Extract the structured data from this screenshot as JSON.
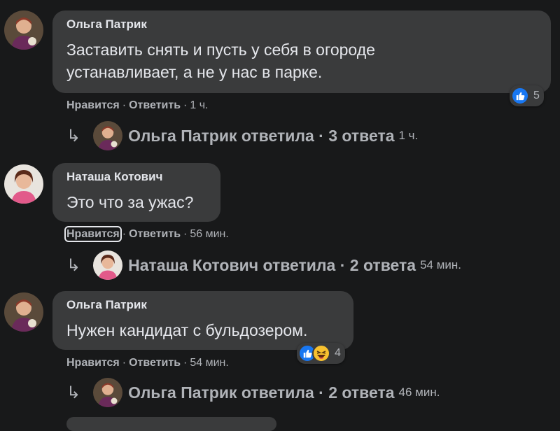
{
  "comments": [
    {
      "author": "Ольга Патрик",
      "text_lines": [
        "Заставить снять и пусть у себя в огороде",
        "устанавливает, а не у нас в парке."
      ],
      "like_label": "Нравится",
      "reply_label": "Ответить",
      "time": "1 ч.",
      "reaction_count": "5",
      "reactions": [
        "like-icon"
      ],
      "reply_summary": "Ольга Патрик ответила · 3 ответа",
      "reply_time": "1 ч."
    },
    {
      "author": "Наташа Котович",
      "text_lines": [
        "Это что за ужас?"
      ],
      "like_label": "Нравится",
      "reply_label": "Ответить",
      "time": "56 мин.",
      "reply_summary": "Наташа Котович ответила · 2 ответа",
      "reply_time": "54 мин."
    },
    {
      "author": "Ольга Патрик",
      "text_lines": [
        "Нужен кандидат с бульдозером."
      ],
      "like_label": "Нравится",
      "reply_label": "Ответить",
      "time": "54 мин.",
      "reaction_count": "4",
      "reactions": [
        "like-icon",
        "haha-icon"
      ],
      "reply_summary": "Ольга Патрик ответила · 2 ответа",
      "reply_time": "46 мин."
    }
  ],
  "separator": "·",
  "reply_arrow": "↳",
  "colors": {
    "background": "#18191a",
    "bubble": "#3a3b3c",
    "text": "#e4e6eb",
    "secondary": "#b0b3b8",
    "like_blue": "#1877f2",
    "haha_yellow": "#f7c12f"
  }
}
